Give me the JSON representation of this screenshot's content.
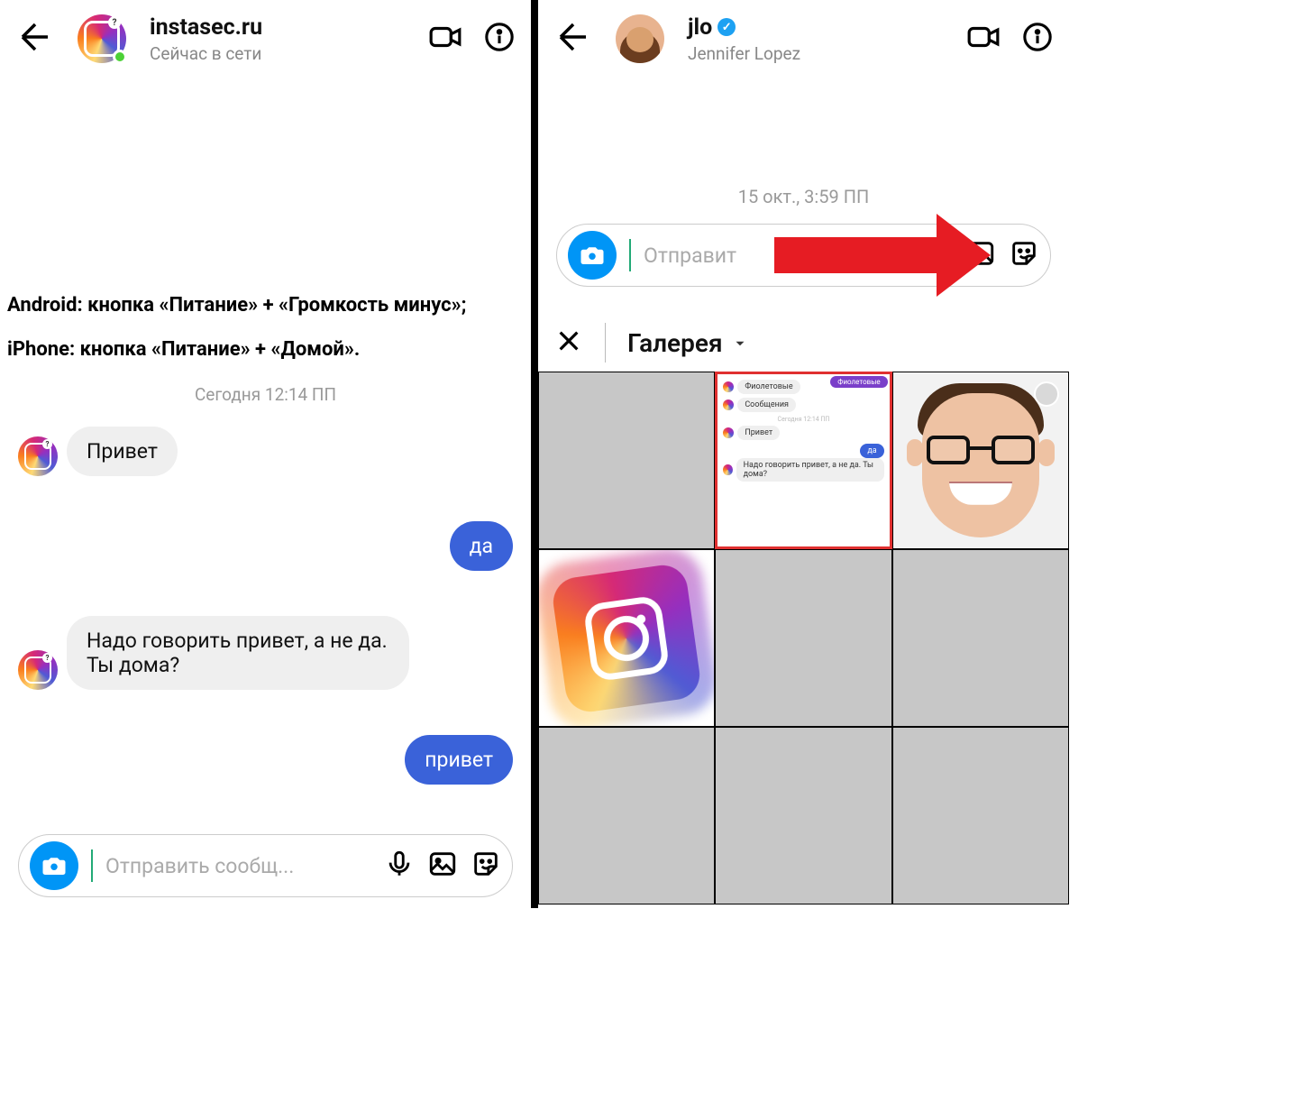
{
  "left": {
    "header": {
      "username": "instasec.ru",
      "status": "Сейчас в сети"
    },
    "notes": {
      "line1": "Android: кнопка «Питание» + «Громкость минус»;",
      "line2": "iPhone: кнопка «Питание» + «Домой»."
    },
    "timestamp": "Сегодня 12:14 ПП",
    "messages": {
      "m1": "Привет",
      "m2": "да",
      "m3": "Надо говорить привет, а не да. Ты дома?",
      "m4": "привет"
    },
    "composer": {
      "placeholder": "Отправить сообщ..."
    }
  },
  "right": {
    "header": {
      "username": "jlo",
      "subtitle": "Jennifer Lopez"
    },
    "timestamp": "15 окт., 3:59 ПП",
    "composer": {
      "placeholder": "Отправит"
    },
    "gallery": {
      "title": "Галерея"
    },
    "tile2": {
      "badge": "Фиолетовые",
      "b1": "Фиолетовые",
      "b2": "Сообщения",
      "ts": "Сегодня 12:14 ПП",
      "b3": "Привет",
      "b4": "да",
      "b5": "Надо говорить привет, а не да. Ты дома?"
    }
  }
}
